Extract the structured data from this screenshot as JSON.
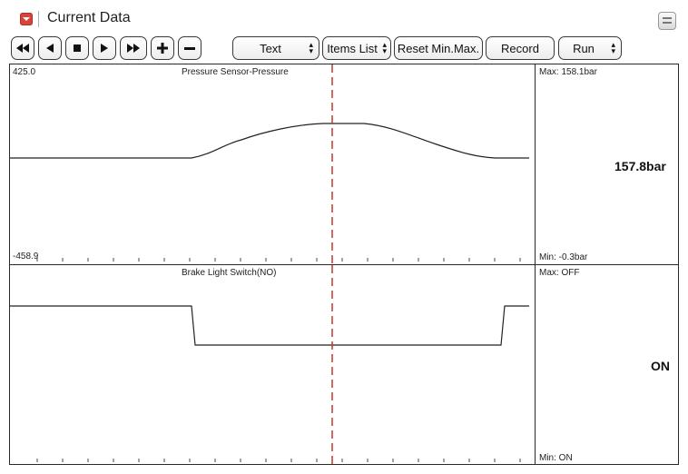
{
  "window": {
    "title": "Current Data"
  },
  "toolbar": {
    "display_mode": "Text",
    "items_list": "Items List",
    "reset": "Reset Min.Max.",
    "record": "Record",
    "run": "Run",
    "icons": [
      "rewind-icon",
      "step-back-icon",
      "stop-icon",
      "play-icon",
      "fast-forward-icon",
      "zoom-in-icon",
      "zoom-out-icon"
    ]
  },
  "graphs": [
    {
      "name": "Pressure Sensor-Pressure",
      "scale_max": "425.0",
      "scale_min": "-458.9",
      "max_label": "Max: 158.1bar",
      "min_label": "Min:  -0.3bar",
      "current": "157.8bar",
      "line_color": "#222222"
    },
    {
      "name": "Brake Light Switch(NO)",
      "max_label": "Max: OFF",
      "min_label": "Min: ON",
      "current": "ON",
      "line_color": "#222222"
    }
  ],
  "cursor_color": "#c0392b"
}
